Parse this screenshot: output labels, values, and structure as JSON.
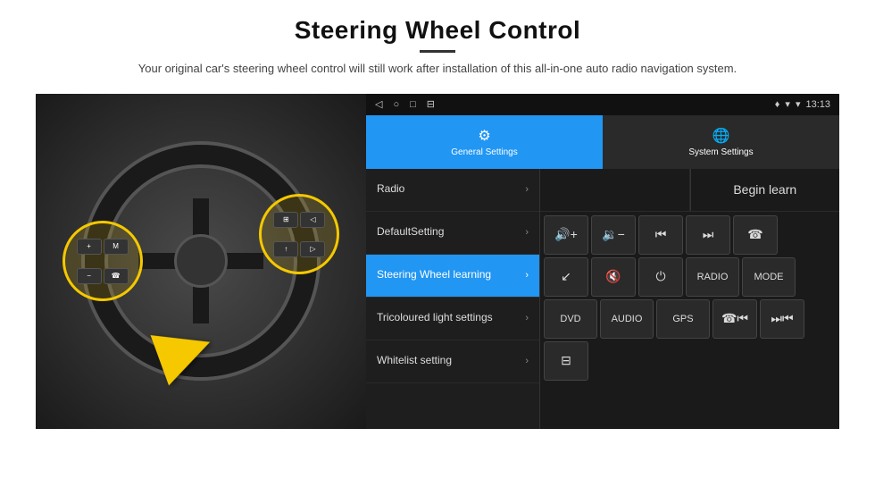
{
  "header": {
    "title": "Steering Wheel Control",
    "subtitle": "Your original car's steering wheel control will still work after installation of this all-in-one auto radio navigation system."
  },
  "status_bar": {
    "nav_icons": [
      "◁",
      "○",
      "□",
      "⊟"
    ],
    "signal_icon": "▼",
    "wifi_icon": "▾",
    "time": "13:13",
    "location_icon": "♦"
  },
  "tabs": [
    {
      "label": "General Settings",
      "active": true
    },
    {
      "label": "System Settings",
      "active": false
    }
  ],
  "menu_items": [
    {
      "label": "Radio",
      "active": false
    },
    {
      "label": "DefaultSetting",
      "active": false
    },
    {
      "label": "Steering Wheel learning",
      "active": true
    },
    {
      "label": "Tricoloured light settings",
      "active": false
    },
    {
      "label": "Whitelist setting",
      "active": false
    }
  ],
  "controls": {
    "begin_learn": "Begin learn",
    "row1_buttons": [
      "◀◀+",
      "◀◀-",
      "⏮",
      "⏭",
      "☎"
    ],
    "row2_buttons": [
      "↙",
      "◀◀×",
      "⏻",
      "RADIO",
      "MODE"
    ],
    "row3_buttons": [
      "DVD",
      "AUDIO",
      "GPS",
      "☎⏮",
      "⏮⏭"
    ],
    "row4_buttons": [
      "⊟"
    ]
  }
}
